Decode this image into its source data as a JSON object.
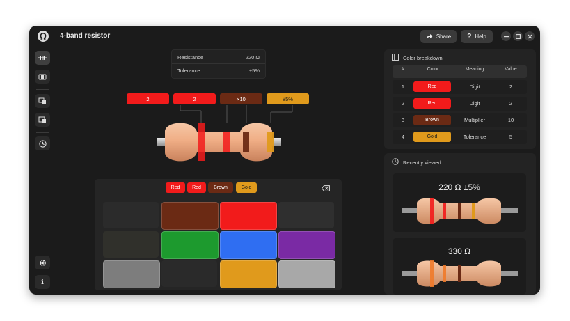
{
  "window": {
    "title": "4-band resistor"
  },
  "toolbar": {
    "share_label": "Share",
    "help_label": "Help"
  },
  "readout": {
    "resistance_label": "Resistance",
    "resistance_value": "220 Ω",
    "tolerance_label": "Tolerance",
    "tolerance_value": "±5%"
  },
  "bands": [
    {
      "label": "2",
      "color": "#f21b1b"
    },
    {
      "label": "2",
      "color": "#f21b1b"
    },
    {
      "label": "×10",
      "color": "#6b2a14"
    },
    {
      "label": "±5%",
      "color": "#e09a1c"
    }
  ],
  "keypad": {
    "selected": [
      {
        "label": "Red",
        "color": "#f21b1b"
      },
      {
        "label": "Red",
        "color": "#f21b1b"
      },
      {
        "label": "Brown",
        "color": "#6b2a14"
      },
      {
        "label": "Gold",
        "color": "#e09a1c"
      }
    ],
    "palette": {
      "black": "#2b2b2b",
      "brown": "#6b2a14",
      "red": "#f21b1b",
      "orange": "#2f2f2f",
      "yellow": "#30302b",
      "green": "#1d9a2e",
      "blue": "#2f6ef2",
      "violet": "#7a2aa4",
      "grey": "#7d7d7d",
      "white": "#2a2a2a",
      "gold": "#e09a1c",
      "silver": "#a8a8a8"
    }
  },
  "breakdown": {
    "title": "Color breakdown",
    "headers": [
      "#",
      "Color",
      "Meaning",
      "Value"
    ],
    "rows": [
      {
        "num": "1",
        "color_label": "Red",
        "color": "#f21b1b",
        "meaning": "Digit",
        "value": "2"
      },
      {
        "num": "2",
        "color_label": "Red",
        "color": "#f21b1b",
        "meaning": "Digit",
        "value": "2"
      },
      {
        "num": "3",
        "color_label": "Brown",
        "color": "#6b2a14",
        "meaning": "Multiplier",
        "value": "10"
      },
      {
        "num": "4",
        "color_label": "Gold",
        "color": "#e09a1c",
        "meaning": "Tolerance",
        "value": "5"
      }
    ]
  },
  "recent": {
    "title": "Recently viewed",
    "items": [
      {
        "label": "220 Ω  ±5%"
      },
      {
        "label": "330 Ω"
      }
    ]
  },
  "colors": {
    "body": "#efb08a",
    "accent": "#f21b1b"
  }
}
